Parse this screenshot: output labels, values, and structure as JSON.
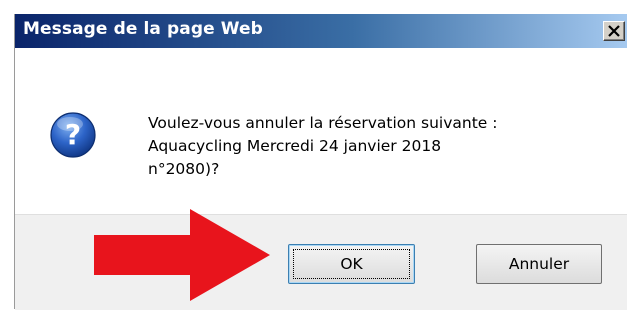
{
  "dialog": {
    "title": "Message de la page Web",
    "message_lines": [
      "Voulez-vous annuler la réservation suivante :",
      "Aquacycling Mercredi 24 janvier 2018",
      "n°2080)?"
    ],
    "icon": "question-icon",
    "buttons": {
      "ok_label": "OK",
      "cancel_label": "Annuler"
    },
    "close_icon": "close-icon"
  },
  "annotation": {
    "arrow_color": "#e8141c",
    "arrow_icon": "arrow-right-icon"
  },
  "colors": {
    "titlebar_start": "#0a246a",
    "titlebar_end": "#a6caf0",
    "button_bar": "#f0f0f0"
  }
}
